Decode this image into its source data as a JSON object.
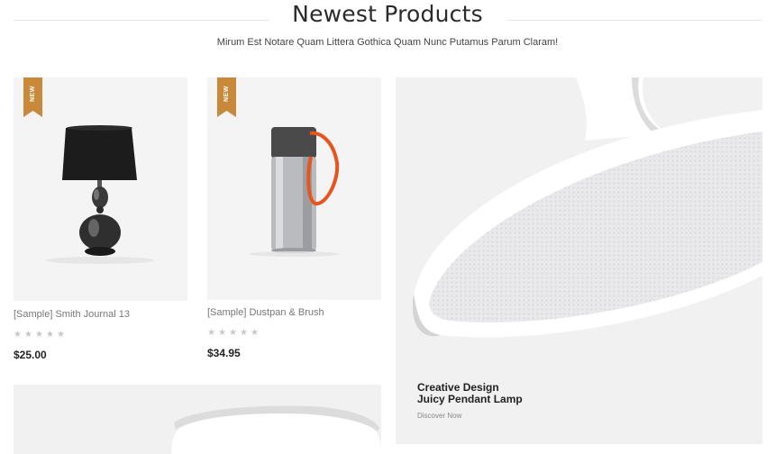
{
  "section": {
    "title": "Newest Products",
    "subtitle": "Mirum Est Notare Quam Littera Gothica Quam Nunc Putamus Parum Claram!"
  },
  "products": [
    {
      "badge": "NEW",
      "title": "[Sample] Smith Journal 13",
      "rating": 0,
      "max_rating": 5,
      "price": "$25.00"
    },
    {
      "badge": "NEW",
      "title": "[Sample] Dustpan & Brush",
      "rating": 0,
      "max_rating": 5,
      "price": "$34.95"
    }
  ],
  "banner": {
    "line1": "Creative Design",
    "line2": "Juicy Pendant Lamp",
    "link": "Discover Now"
  },
  "colors": {
    "badge": "#c8893b",
    "star_empty": "#c8c8c8",
    "card_bg": "#f4f4f4",
    "flask_orange": "#e8541e"
  }
}
